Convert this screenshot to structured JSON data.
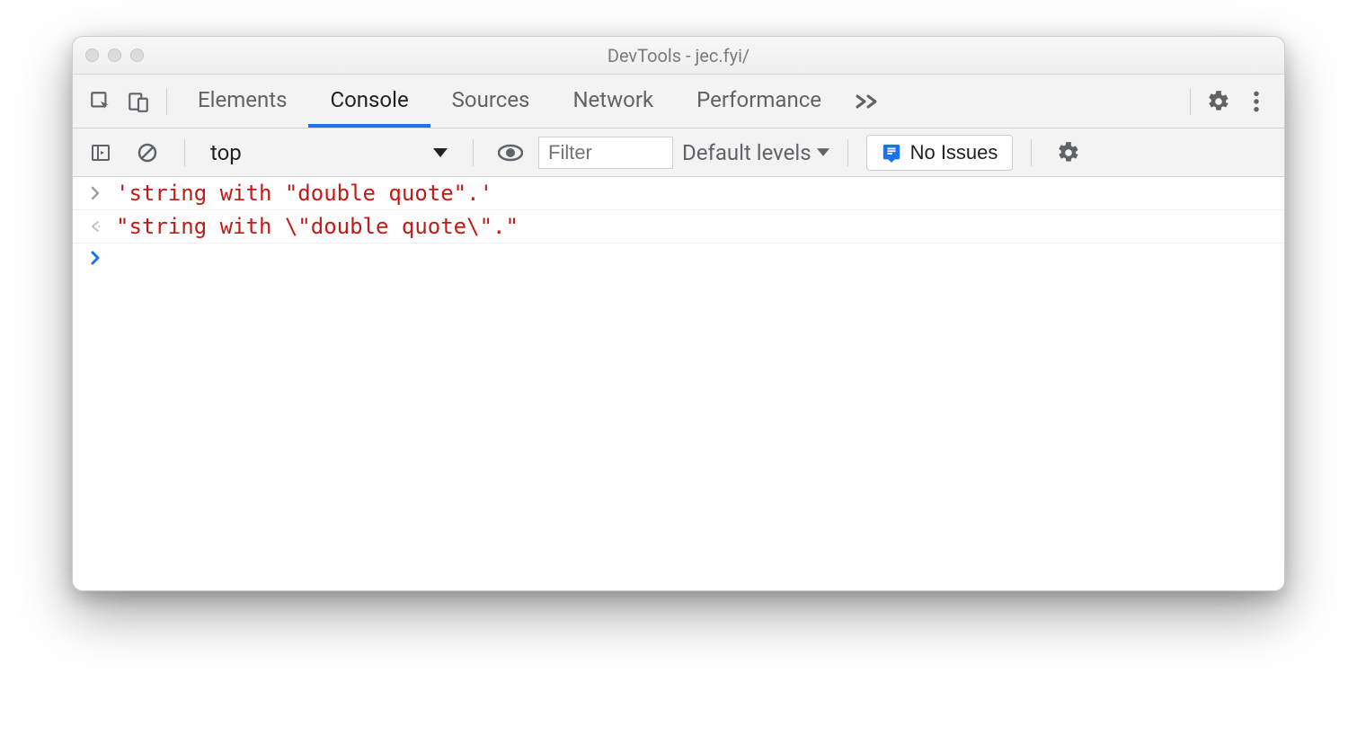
{
  "window": {
    "title": "DevTools - jec.fyi/"
  },
  "tabs": {
    "items": [
      "Elements",
      "Console",
      "Sources",
      "Network",
      "Performance"
    ],
    "active_index": 1
  },
  "toolbar": {
    "context": "top",
    "filter_placeholder": "Filter",
    "levels_label": "Default levels",
    "issues_label": "No Issues"
  },
  "console": {
    "rows": [
      {
        "kind": "input",
        "text": "'string with \"double quote\".'"
      },
      {
        "kind": "output",
        "text": "\"string with \\\"double quote\\\".\""
      }
    ]
  }
}
